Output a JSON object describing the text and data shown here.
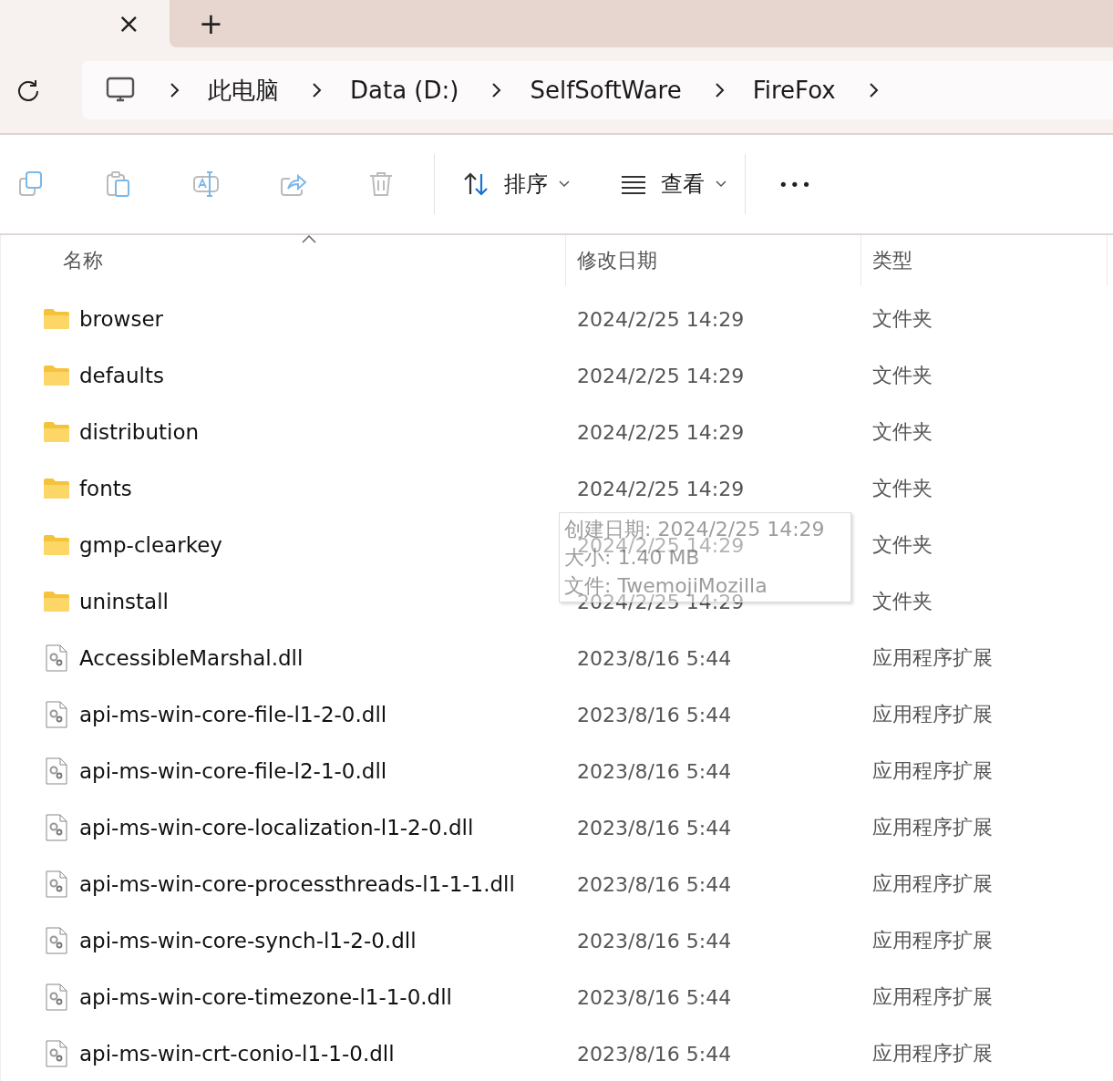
{
  "tabs": {
    "close": "×",
    "new_tab": "+"
  },
  "breadcrumb": [
    {
      "label": "此电脑"
    },
    {
      "label": "Data (D:)"
    },
    {
      "label": "SelfSoftWare"
    },
    {
      "label": "FireFox"
    }
  ],
  "toolbar": {
    "actions": [
      {
        "kind": "copy",
        "disabled": true
      },
      {
        "kind": "paste",
        "disabled": true
      },
      {
        "kind": "rename",
        "disabled": true
      },
      {
        "kind": "share",
        "disabled": true
      },
      {
        "kind": "delete",
        "disabled": true
      }
    ],
    "menus": [
      {
        "kind": "sort",
        "label": "排序"
      },
      {
        "kind": "view",
        "label": "查看"
      }
    ],
    "more": "•••"
  },
  "table": {
    "columns": [
      {
        "label": "名称",
        "sorted": true
      },
      {
        "label": "修改日期",
        "sorted": false
      },
      {
        "label": "类型",
        "sorted": false
      }
    ],
    "rows": [
      {
        "kind": "folder",
        "name": "browser",
        "modified": "2024/2/25 14:29",
        "type": "文件夹"
      },
      {
        "kind": "folder",
        "name": "defaults",
        "modified": "2024/2/25 14:29",
        "type": "文件夹"
      },
      {
        "kind": "folder",
        "name": "distribution",
        "modified": "2024/2/25 14:29",
        "type": "文件夹"
      },
      {
        "kind": "folder",
        "name": "fonts",
        "modified": "2024/2/25 14:29",
        "type": "文件夹"
      },
      {
        "kind": "folder",
        "name": "gmp-clearkey",
        "modified": "2024/2/25 14:29",
        "type": "文件夹"
      },
      {
        "kind": "folder",
        "name": "uninstall",
        "modified": "2024/2/25 14:29",
        "type": "文件夹"
      },
      {
        "kind": "dll",
        "name": "AccessibleMarshal.dll",
        "modified": "2023/8/16 5:44",
        "type": "应用程序扩展"
      },
      {
        "kind": "dll",
        "name": "api-ms-win-core-file-l1-2-0.dll",
        "modified": "2023/8/16 5:44",
        "type": "应用程序扩展"
      },
      {
        "kind": "dll",
        "name": "api-ms-win-core-file-l2-1-0.dll",
        "modified": "2023/8/16 5:44",
        "type": "应用程序扩展"
      },
      {
        "kind": "dll",
        "name": "api-ms-win-core-localization-l1-2-0.dll",
        "modified": "2023/8/16 5:44",
        "type": "应用程序扩展"
      },
      {
        "kind": "dll",
        "name": "api-ms-win-core-processthreads-l1-1-1.dll",
        "modified": "2023/8/16 5:44",
        "type": "应用程序扩展"
      },
      {
        "kind": "dll",
        "name": "api-ms-win-core-synch-l1-2-0.dll",
        "modified": "2023/8/16 5:44",
        "type": "应用程序扩展"
      },
      {
        "kind": "dll",
        "name": "api-ms-win-core-timezone-l1-1-0.dll",
        "modified": "2023/8/16 5:44",
        "type": "应用程序扩展"
      },
      {
        "kind": "dll",
        "name": "api-ms-win-crt-conio-l1-1-0.dll",
        "modified": "2023/8/16 5:44",
        "type": "应用程序扩展"
      }
    ]
  },
  "tooltip": {
    "lines": [
      "创建日期: 2024/2/25 14:29",
      "大小: 1.40 MB",
      "文件: TwemojiMozilla"
    ]
  }
}
